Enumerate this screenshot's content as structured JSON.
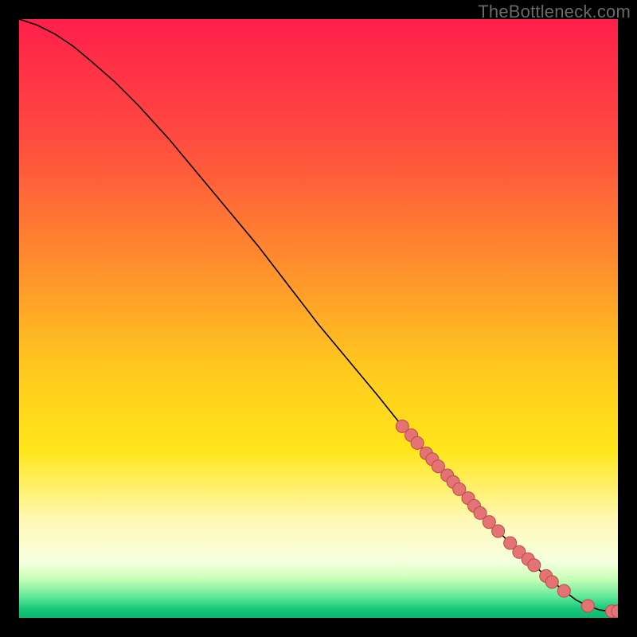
{
  "watermark": "TheBottleneck.com",
  "chart_data": {
    "type": "line",
    "title": "",
    "xlabel": "",
    "ylabel": "",
    "xlim": [
      0,
      100
    ],
    "ylim": [
      0,
      100
    ],
    "grid": false,
    "legend": false,
    "background_gradient_stops": [
      {
        "offset": 0.0,
        "color": "#ff1f4b"
      },
      {
        "offset": 0.2,
        "color": "#ff4b3f"
      },
      {
        "offset": 0.4,
        "color": "#ff8b2e"
      },
      {
        "offset": 0.58,
        "color": "#ffc81f"
      },
      {
        "offset": 0.72,
        "color": "#ffe61a"
      },
      {
        "offset": 0.84,
        "color": "#fff9b8"
      },
      {
        "offset": 0.905,
        "color": "#f6ffe0"
      },
      {
        "offset": 0.935,
        "color": "#c8ffb6"
      },
      {
        "offset": 0.965,
        "color": "#60e89a"
      },
      {
        "offset": 0.985,
        "color": "#16c97a"
      },
      {
        "offset": 1.0,
        "color": "#0fb56e"
      }
    ],
    "series": [
      {
        "name": "curve",
        "type": "line",
        "color": "#000000",
        "x": [
          0,
          3,
          6,
          9,
          12,
          16,
          20,
          25,
          30,
          35,
          40,
          45,
          50,
          55,
          60,
          64,
          68,
          72,
          76,
          80,
          84,
          88,
          91,
          93,
          95,
          97,
          99,
          100
        ],
        "y": [
          100,
          99,
          97.5,
          95.5,
          93,
          89.5,
          85.5,
          80,
          74,
          68,
          62,
          55.5,
          49,
          43,
          37,
          32,
          27.5,
          23,
          18.5,
          14.5,
          10.5,
          7,
          4.5,
          3,
          2,
          1.3,
          1.1,
          1.1
        ]
      },
      {
        "name": "markers",
        "type": "scatter",
        "color": "#e57373",
        "border": "#b84a4a",
        "radius": 8,
        "x": [
          64,
          65.5,
          66.5,
          68,
          69,
          70,
          71.5,
          72.5,
          73.5,
          75,
          76,
          77,
          78.5,
          80,
          82,
          83.5,
          85,
          86,
          88,
          89,
          91,
          95,
          99,
          100
        ],
        "y": [
          32,
          30.5,
          29.2,
          27.5,
          26.5,
          25.3,
          23.8,
          22.7,
          21.5,
          20,
          18.7,
          17.5,
          16,
          14.5,
          12.5,
          11,
          9.8,
          8.8,
          7,
          6,
          4.5,
          2,
          1.1,
          1.1
        ]
      }
    ]
  }
}
